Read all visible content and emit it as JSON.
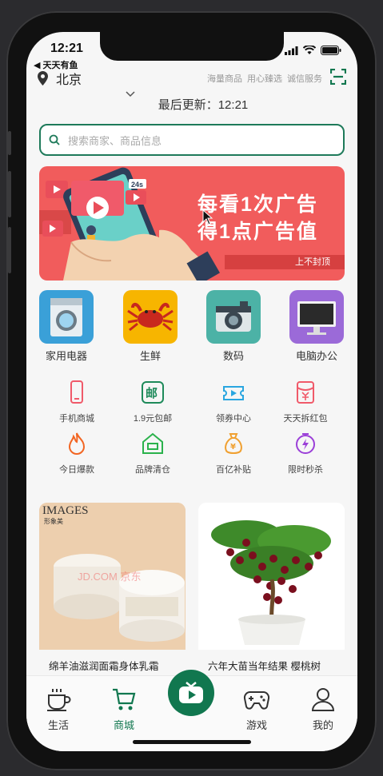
{
  "status": {
    "time": "12:21",
    "back_app": "◀ 天天有鱼"
  },
  "header": {
    "location": "北京",
    "links": [
      "海量商品",
      "用心臻选",
      "诚信服务"
    ],
    "scan_icon": "scan-icon",
    "update_text": "最后更新：12:21"
  },
  "search": {
    "placeholder": "搜索商家、商品信息"
  },
  "banner": {
    "line1": "每看1次广告",
    "line2": "得1点广告值",
    "tag": "上不封顶",
    "badge": "24s"
  },
  "categories": [
    {
      "label": "家用电器",
      "color": "#3aa0d8",
      "icon": "washing-machine-icon"
    },
    {
      "label": "生鲜",
      "color": "#f7b500",
      "icon": "crab-icon"
    },
    {
      "label": "数码",
      "color": "#4cb2a6",
      "icon": "camera-icon"
    },
    {
      "label": "电脑办公",
      "color": "#9b6ad8",
      "icon": "monitor-icon"
    }
  ],
  "services": [
    {
      "label": "手机商城",
      "color": "#f05a6a",
      "icon": "phone-icon"
    },
    {
      "label": "1.9元包邮",
      "color": "#1e8a5a",
      "icon": "mail-icon"
    },
    {
      "label": "领券中心",
      "color": "#2aa6e0",
      "icon": "coupon-icon"
    },
    {
      "label": "天天拆红包",
      "color": "#f05a6a",
      "icon": "red-packet-icon"
    },
    {
      "label": "今日爆款",
      "color": "#f26522",
      "icon": "fire-icon"
    },
    {
      "label": "品牌清仓",
      "color": "#2bb24c",
      "icon": "store-icon"
    },
    {
      "label": "百亿补贴",
      "color": "#f0a030",
      "icon": "money-bag-icon"
    },
    {
      "label": "限时秒杀",
      "color": "#9b3fd8",
      "icon": "lightning-icon"
    }
  ],
  "products": [
    {
      "title": "绵羊油滋润面霜身体乳霜",
      "brand": "IMAGES",
      "brand_sub": "形象美",
      "watermark": "JD.COM 京东"
    },
    {
      "title": "六年大苗当年结果 樱桃树"
    }
  ],
  "tabs": [
    {
      "label": "生活",
      "icon": "coffee-cup-icon",
      "active": false
    },
    {
      "label": "商城",
      "icon": "shopping-cart-icon",
      "active": true
    },
    {
      "label": "",
      "icon": "tv-play-icon",
      "active": false
    },
    {
      "label": "游戏",
      "icon": "gamepad-icon",
      "active": false
    },
    {
      "label": "我的",
      "icon": "user-icon",
      "active": false
    }
  ],
  "colors": {
    "accent": "#11774f",
    "banner": "#f15c5c"
  }
}
